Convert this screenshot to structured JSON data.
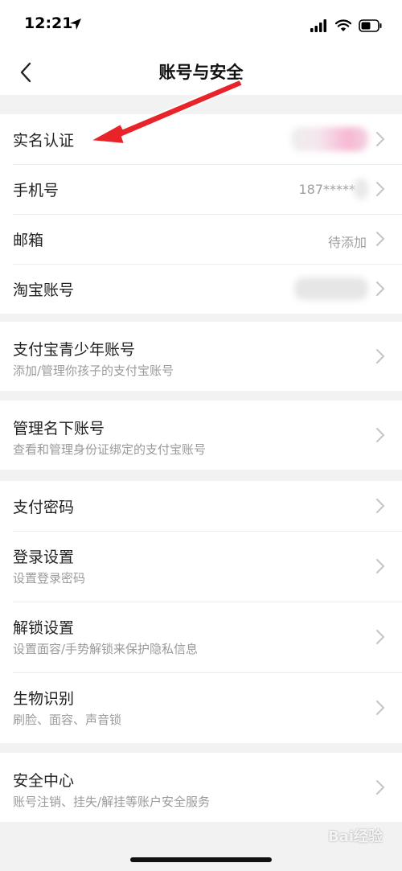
{
  "status": {
    "time": "12:21"
  },
  "nav": {
    "title": "账号与安全"
  },
  "group1": {
    "realname": {
      "label": "实名认证"
    },
    "phone": {
      "label": "手机号",
      "value": "187*****"
    },
    "email": {
      "label": "邮箱",
      "value": "待添加"
    },
    "taobao": {
      "label": "淘宝账号"
    }
  },
  "group2": {
    "youth": {
      "label": "支付宝青少年账号",
      "sub": "添加/管理你孩子的支付宝账号"
    }
  },
  "group3": {
    "manage": {
      "label": "管理名下账号",
      "sub": "查看和管理身份证绑定的支付宝账号"
    }
  },
  "group4": {
    "paypwd": {
      "label": "支付密码"
    },
    "login": {
      "label": "登录设置",
      "sub": "设置登录密码"
    },
    "unlock": {
      "label": "解锁设置",
      "sub": "设置面容/手势解锁来保护隐私信息"
    },
    "bio": {
      "label": "生物识别",
      "sub": "刷脸、面容、声音锁"
    }
  },
  "group5": {
    "security": {
      "label": "安全中心",
      "sub": "账号注销、挂失/解挂等账户安全服务"
    }
  },
  "watermark": "Bai经验",
  "colors": {
    "arrow": "#e8242a",
    "background": "#f2f2f2",
    "card": "#ffffff"
  }
}
